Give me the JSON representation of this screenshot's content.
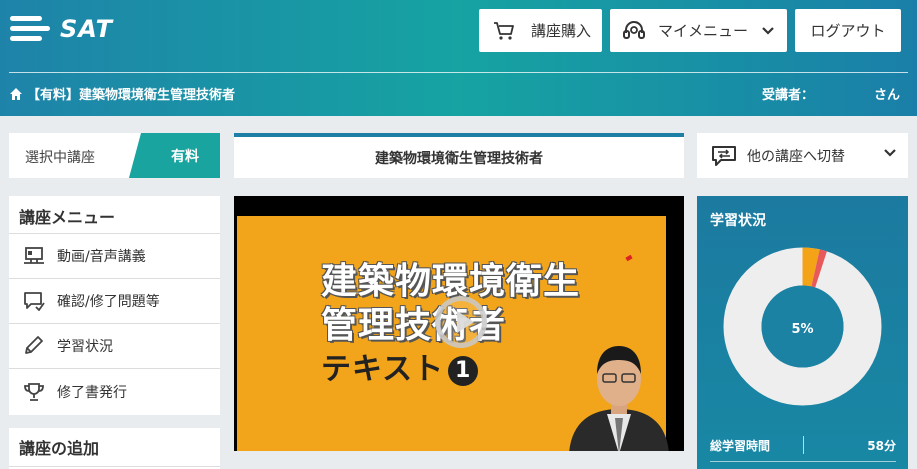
{
  "header": {
    "logo_text": "SAT",
    "buy_label": "講座購入",
    "mymenu_label": "マイメニュー",
    "logout_label": "ログアウト",
    "breadcrumb": "【有料】建築物環境衛生管理技術者",
    "student_label": "受講者：",
    "student_suffix": "さん"
  },
  "course": {
    "selected_label": "選択中講座",
    "paid_label": "有料",
    "title": "建築物環境衛生管理技術者",
    "switch_label": "他の講座へ切替"
  },
  "menu": {
    "title": "講座メニュー",
    "items": [
      {
        "label": "動画/音声講義",
        "icon": "video-lecture-icon"
      },
      {
        "label": "確認/修了問題等",
        "icon": "quiz-icon"
      },
      {
        "label": "学習状況",
        "icon": "pencil-icon"
      },
      {
        "label": "修了書発行",
        "icon": "trophy-icon"
      }
    ],
    "add_title": "講座の追加"
  },
  "video": {
    "line1": "建築物環境衛生",
    "line2": "管理技術者",
    "line3": "テキスト",
    "badge": "1"
  },
  "progress": {
    "title": "学習状況",
    "percent_label": "5%",
    "percent": 5,
    "total_time_label": "総学習時間",
    "total_time_value": "58分"
  },
  "colors": {
    "accent": "#19a4a0",
    "header_blue": "#1e83a9",
    "donut_orange": "#f5a316",
    "donut_red": "#e85a5a",
    "donut_track": "#eeeeee"
  }
}
